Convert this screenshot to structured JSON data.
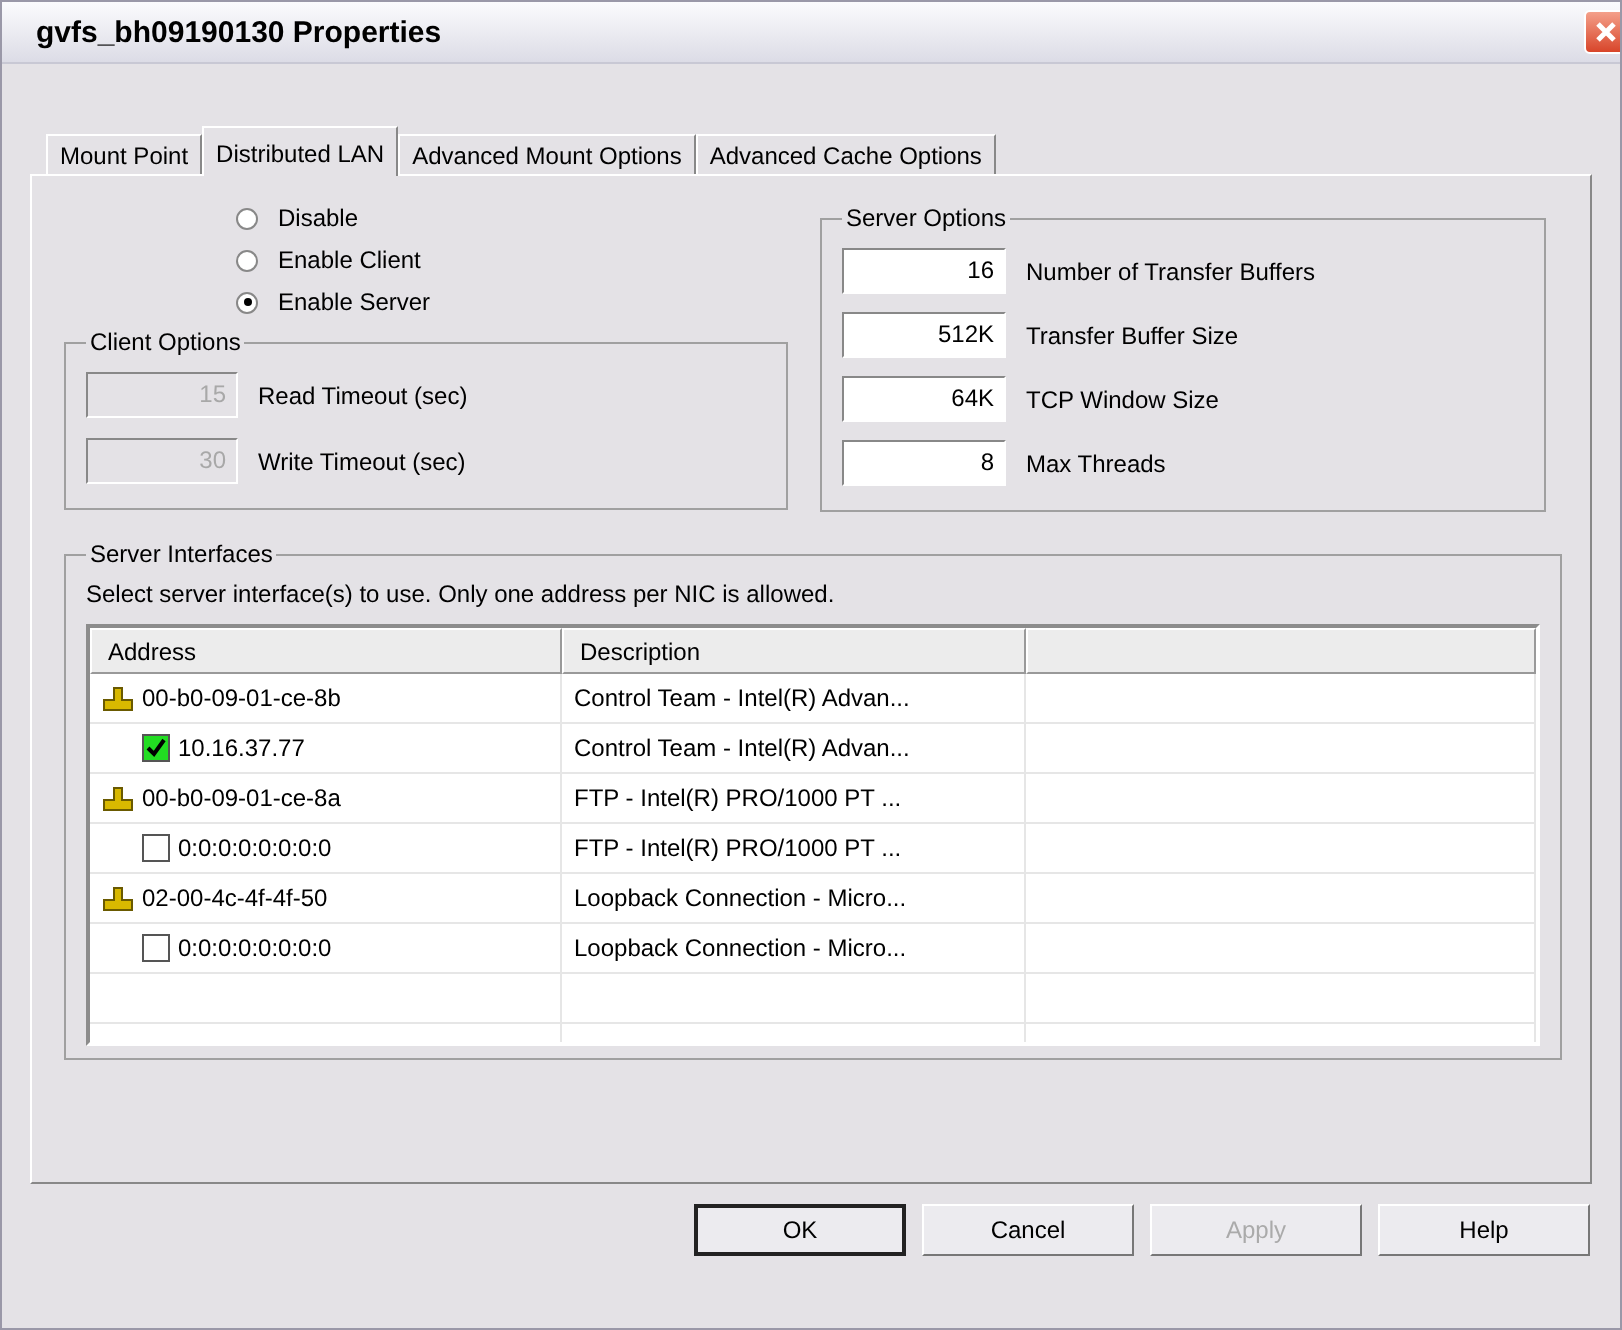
{
  "window": {
    "title": "gvfs_bh09190130 Properties"
  },
  "tabs": [
    {
      "label": "Mount Point",
      "selected": false
    },
    {
      "label": "Distributed LAN",
      "selected": true
    },
    {
      "label": "Advanced Mount Options",
      "selected": false
    },
    {
      "label": "Advanced Cache Options",
      "selected": false
    }
  ],
  "mode": [
    {
      "label": "Disable",
      "selected": false
    },
    {
      "label": "Enable Client",
      "selected": false
    },
    {
      "label": "Enable Server",
      "selected": true
    }
  ],
  "client_options": {
    "title": "Client Options",
    "fields": [
      {
        "value": "15",
        "label": "Read Timeout (sec)",
        "disabled": true
      },
      {
        "value": "30",
        "label": "Write Timeout (sec)",
        "disabled": true
      }
    ]
  },
  "server_options": {
    "title": "Server Options",
    "fields": [
      {
        "value": "16",
        "label": "Number of Transfer Buffers",
        "disabled": false
      },
      {
        "value": "512K",
        "label": "Transfer Buffer Size",
        "disabled": false
      },
      {
        "value": "64K",
        "label": "TCP Window Size",
        "disabled": false
      },
      {
        "value": "8",
        "label": "Max Threads",
        "disabled": false
      }
    ]
  },
  "server_interfaces": {
    "title": "Server Interfaces",
    "hint": "Select server interface(s) to use.  Only one address per NIC is allowed.",
    "columns": [
      "Address",
      "Description"
    ],
    "rows": [
      {
        "address": "00-b0-09-01-ce-8b",
        "description": "Control Team - Intel(R) Advan...",
        "children": [
          {
            "address": "10.16.37.77",
            "description": "Control Team - Intel(R) Advan...",
            "checked": true
          }
        ]
      },
      {
        "address": "00-b0-09-01-ce-8a",
        "description": "FTP - Intel(R) PRO/1000 PT ...",
        "children": [
          {
            "address": "0:0:0:0:0:0:0:0",
            "description": "FTP - Intel(R) PRO/1000 PT ...",
            "checked": false
          }
        ]
      },
      {
        "address": "02-00-4c-4f-4f-50",
        "description": "Loopback Connection - Micro...",
        "children": [
          {
            "address": "0:0:0:0:0:0:0:0",
            "description": "Loopback Connection - Micro...",
            "checked": false
          }
        ]
      }
    ]
  },
  "buttons": [
    {
      "label": "OK",
      "default": true,
      "disabled": false
    },
    {
      "label": "Cancel",
      "default": false,
      "disabled": false
    },
    {
      "label": "Apply",
      "default": false,
      "disabled": true
    },
    {
      "label": "Help",
      "default": false,
      "disabled": false
    }
  ]
}
